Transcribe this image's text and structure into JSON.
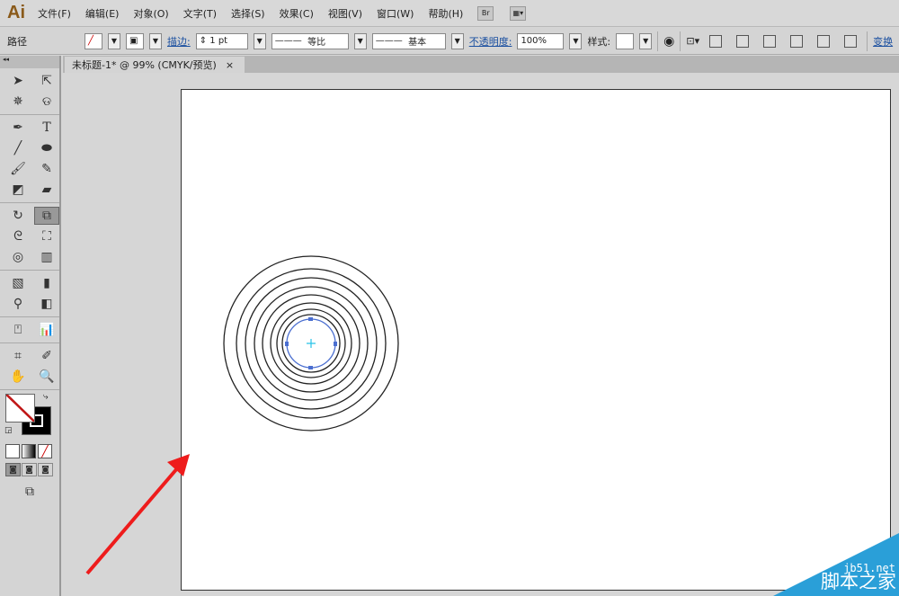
{
  "app": {
    "logo": "Ai"
  },
  "menu": [
    "文件(F)",
    "编辑(E)",
    "对象(O)",
    "文字(T)",
    "选择(S)",
    "效果(C)",
    "视图(V)",
    "窗口(W)",
    "帮助(H)"
  ],
  "bridge_label": "Br",
  "control": {
    "selection": "路径",
    "stroke_label": "描边:",
    "stroke_weight": "1 pt",
    "profile": "等比",
    "brush": "基本",
    "opacity_label": "不透明度:",
    "opacity": "100%",
    "style_label": "样式:",
    "transform_label": "变换"
  },
  "tab": {
    "title": "未标题-1* @ 99% (CMYK/预览)",
    "close": "×"
  },
  "watermark": {
    "site": "jb51.net",
    "name": "脚本之家"
  },
  "colors": {
    "accent": "#2a9fd8",
    "arrow": "#ee1c1c"
  }
}
